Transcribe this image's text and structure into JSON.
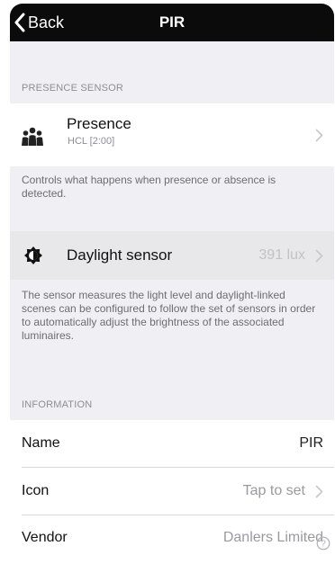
{
  "nav": {
    "back_label": "Back",
    "title": "PIR"
  },
  "presence_section": {
    "header": "PRESENCE SENSOR",
    "row_title": "Presence",
    "row_subtitle": "HCL [2:00]",
    "footer": "Controls what happens when presence or absence is detected."
  },
  "daylight_section": {
    "row_title": "Daylight sensor",
    "row_value": "391 lux",
    "footer": "The sensor measures the light level and daylight-linked scenes can be configured to follow the set of sensors in order to automatically adjust the brightness of the associated luminaires."
  },
  "information_section": {
    "header": "INFORMATION",
    "rows": [
      {
        "label": "Name",
        "value": "PIR"
      },
      {
        "label": "Icon",
        "value": "Tap to set"
      },
      {
        "label": "Vendor",
        "value": "Danlers Limited"
      }
    ]
  },
  "colors": {
    "navbar": "#0b0b0b",
    "background": "#efeff4",
    "chevron": "#c7c7cc",
    "secondary_text": "#8e8e93"
  },
  "icons": {
    "back": "chevron-left-icon",
    "presence": "people-icon",
    "daylight": "brightness-icon",
    "help": "help-icon"
  }
}
